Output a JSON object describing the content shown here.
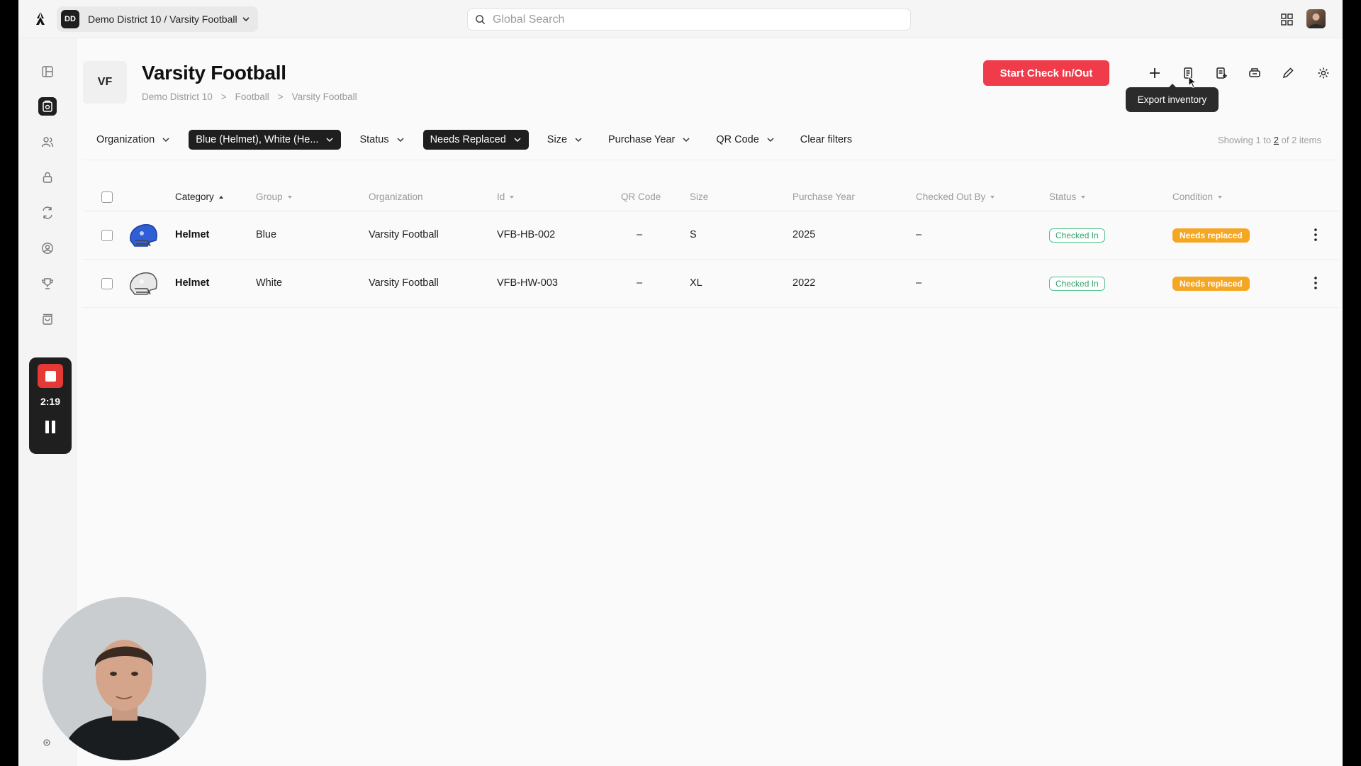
{
  "topbar": {
    "org_initials": "DD",
    "org_path": "Demo District 10 / Varsity Football",
    "search_placeholder": "Global Search"
  },
  "recorder": {
    "time": "2:19"
  },
  "header": {
    "avatar_initials": "VF",
    "title": "Varsity Football",
    "breadcrumb": [
      "Demo District 10",
      "Football",
      "Varsity Football"
    ],
    "primary_button": "Start Check In/Out",
    "tooltip": "Export inventory"
  },
  "filters": [
    {
      "label": "Organization",
      "active": false
    },
    {
      "label": "Blue (Helmet), White (He...",
      "active": true
    },
    {
      "label": "Status",
      "active": false
    },
    {
      "label": "Needs Replaced",
      "active": true
    },
    {
      "label": "Size",
      "active": false
    },
    {
      "label": "Purchase Year",
      "active": false
    },
    {
      "label": "QR Code",
      "active": false
    }
  ],
  "clear_filters": "Clear filters",
  "showing": {
    "prefix": "Showing 1 to",
    "to": "2",
    "suffix": "of 2 items"
  },
  "table": {
    "columns": [
      "Category",
      "Group",
      "Organization",
      "Id",
      "QR Code",
      "Size",
      "Purchase Year",
      "Checked Out By",
      "Status",
      "Condition"
    ],
    "rows": [
      {
        "category": "Helmet",
        "group": "Blue",
        "organization": "Varsity Football",
        "id": "VFB-HB-002",
        "qr": "–",
        "size": "S",
        "year": "2025",
        "checked_out_by": "–",
        "status": "Checked In",
        "condition": "Needs replaced",
        "thumb_color": "#2f5fd6"
      },
      {
        "category": "Helmet",
        "group": "White",
        "organization": "Varsity Football",
        "id": "VFB-HW-003",
        "qr": "–",
        "size": "XL",
        "year": "2022",
        "checked_out_by": "–",
        "status": "Checked In",
        "condition": "Needs replaced",
        "thumb_color": "#e8e8e8"
      }
    ]
  },
  "colors": {
    "primary": "#ef3b4a",
    "status_in": "#2fa36a",
    "condition": "#f5a623"
  }
}
